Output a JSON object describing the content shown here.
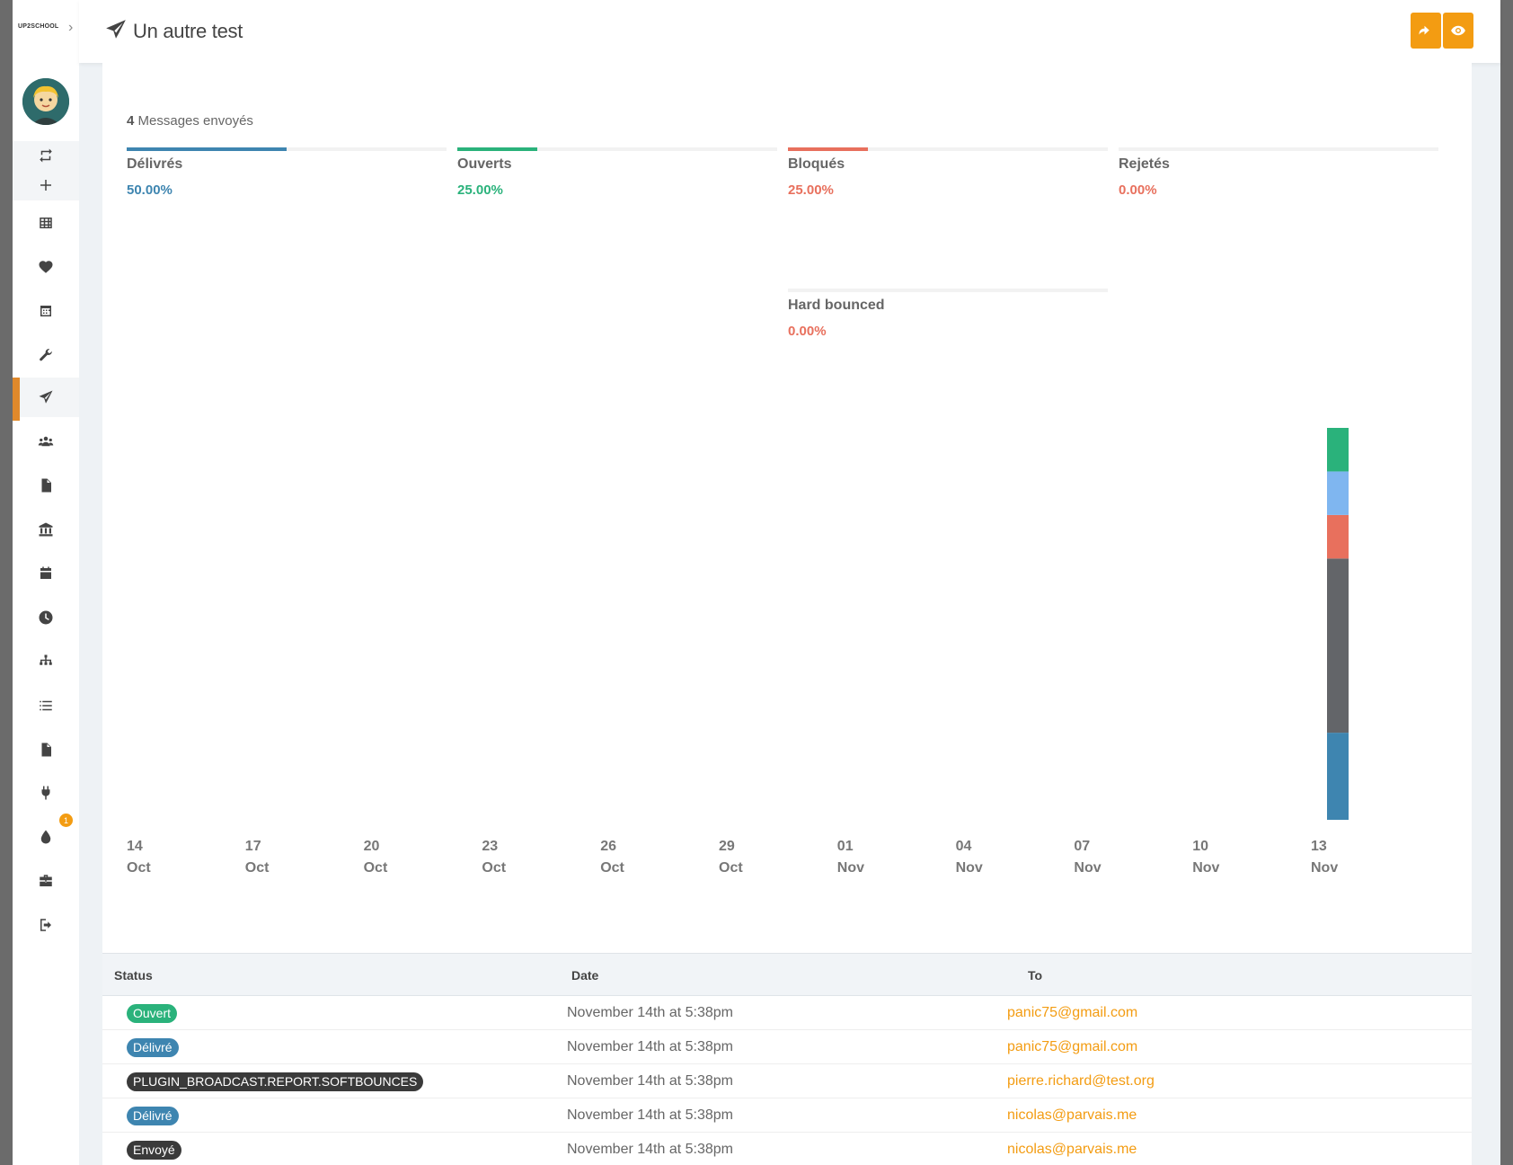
{
  "header": {
    "title": "Un autre test"
  },
  "sidebar": {
    "logo": "UP2SCHOOL",
    "notification_count": "1"
  },
  "summary": {
    "count": "4",
    "label": "Messages envoyés"
  },
  "stats": [
    {
      "label": "Délivrés",
      "value": "50.00%",
      "fraction": 0.5,
      "color": "#3e85b0"
    },
    {
      "label": "Ouverts",
      "value": "25.00%",
      "fraction": 0.25,
      "color": "#2ab27b"
    },
    {
      "label": "Bloqués",
      "value": "25.00%",
      "fraction": 0.25,
      "color": "#e8705d"
    },
    {
      "label": "Rejetés",
      "value": "0.00%",
      "fraction": 0,
      "color": "#e8705d"
    },
    {
      "label": "Hard bounced",
      "value": "0.00%",
      "fraction": 0,
      "color": "#e8705d"
    }
  ],
  "chart_data": {
    "type": "bar",
    "stacked": true,
    "x_ticks": [
      [
        "14",
        "Oct"
      ],
      [
        "17",
        "Oct"
      ],
      [
        "20",
        "Oct"
      ],
      [
        "23",
        "Oct"
      ],
      [
        "26",
        "Oct"
      ],
      [
        "29",
        "Oct"
      ],
      [
        "01",
        "Nov"
      ],
      [
        "04",
        "Nov"
      ],
      [
        "07",
        "Nov"
      ],
      [
        "10",
        "Nov"
      ],
      [
        "13",
        "Nov"
      ]
    ],
    "categories": [
      "14 Nov"
    ],
    "series": [
      {
        "values": [
          1
        ],
        "color": "#3e85b0"
      },
      {
        "values": [
          2
        ],
        "color": "#636569"
      },
      {
        "values": [
          0.5
        ],
        "color": "#e8705d"
      },
      {
        "values": [
          0.5
        ],
        "color": "#7fb6f0"
      },
      {
        "values": [
          0.5
        ],
        "color": "#2ab27b"
      }
    ],
    "grid": false,
    "legend": "none"
  },
  "table": {
    "headers": [
      "Status",
      "Date",
      "To"
    ],
    "rows": [
      {
        "status": "Ouvert",
        "status_color": "#2ab27b",
        "date": "November 14th at 5:38pm",
        "to": "panic75@gmail.com"
      },
      {
        "status": "Délivré",
        "status_color": "#3e85b0",
        "date": "November 14th at 5:38pm",
        "to": "panic75@gmail.com"
      },
      {
        "status": "PLUGIN_BROADCAST.REPORT.SOFTBOUNCES",
        "status_color": "#3a3a3a",
        "date": "November 14th at 5:38pm",
        "to": "pierre.richard@test.org"
      },
      {
        "status": "Délivré",
        "status_color": "#3e85b0",
        "date": "November 14th at 5:38pm",
        "to": "nicolas@parvais.me"
      },
      {
        "status": "Envoyé",
        "status_color": "#3a3a3a",
        "date": "November 14th at 5:38pm",
        "to": "nicolas@parvais.me"
      }
    ]
  },
  "colors": {
    "accent": "#f39c12",
    "active_nav": "#e0892b"
  }
}
